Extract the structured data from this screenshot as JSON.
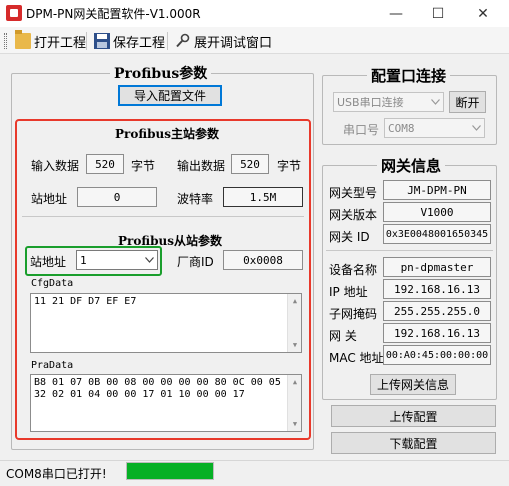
{
  "window": {
    "title": "DPM-PN网关配置软件-V1.000R",
    "minimize_glyph": "—",
    "maximize_glyph": "☐",
    "close_glyph": "✕"
  },
  "toolbar": {
    "open_label": "打开工程",
    "save_label": "保存工程",
    "debug_label": "展开调试窗口"
  },
  "profibus": {
    "group_title": "Profibus参数",
    "import_button": "导入配置文件",
    "master": {
      "title": "Profibus主站参数",
      "input_label": "输入数据",
      "input_value": "520",
      "input_unit": "字节",
      "output_label": "输出数据",
      "output_value": "520",
      "output_unit": "字节",
      "address_label": "站地址",
      "address_value": "0",
      "baud_label": "波特率",
      "baud_value": "1.5M"
    },
    "slave": {
      "title": "Profibus从站参数",
      "address_label": "站地址",
      "address_value": "1",
      "vendor_label": "厂商ID",
      "vendor_value": "0x0008",
      "cfg_label": "CfgData",
      "cfg_value": "11 21 DF D7 EF E7",
      "pra_label": "PraData",
      "pra_line1": "B8 01 07 0B 00 08 00 00 00 00 80 0C 00 05",
      "pra_line2": "32 02 01 04 00 00 17 01 10 00 00 17"
    }
  },
  "config_port": {
    "title": "配置口连接",
    "port_type_value": "USB串口连接",
    "disconnect_button": "断开",
    "port_label": "串口号",
    "port_value": "COM8"
  },
  "gateway": {
    "title": "网关信息",
    "model_label": "网关型号",
    "model_value": "JM-DPM-PN",
    "version_label": "网关版本",
    "version_value": "V1000",
    "id_label": "网关 ID",
    "id_value": "0x3E0048001650345",
    "device_label": "设备名称",
    "device_value": "pn-dpmaster",
    "ip_label": "IP  地址",
    "ip_value": "192.168.16.13",
    "mask_label": "子网掩码",
    "mask_value": "255.255.255.0",
    "gw_label": "网    关",
    "gw_value": "192.168.16.13",
    "mac_label": "MAC 地址",
    "mac_value": "00:A0:45:00:00:00",
    "upload_info_button": "上传网关信息"
  },
  "actions": {
    "upload_config": "上传配置",
    "download_config": "下载配置"
  },
  "status": {
    "text": "COM8串口已打开!",
    "progress": 1.0,
    "progress_color": "#06b025"
  },
  "colors": {
    "highlight_red": "#e8392b",
    "highlight_green": "#1a9e2c",
    "focus_blue": "#0078d7"
  }
}
